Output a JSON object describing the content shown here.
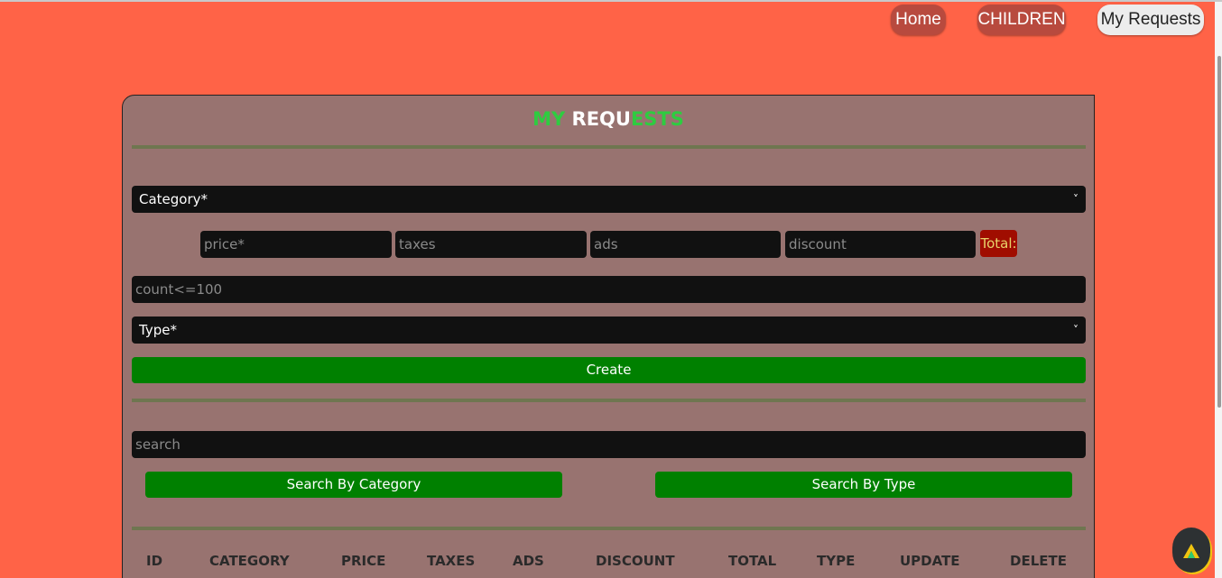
{
  "nav": {
    "home": "Home",
    "children": "CHILDREN",
    "requests": "My Requests"
  },
  "title": {
    "part1": "MY ",
    "part2": "REQU",
    "part3": "ESTS"
  },
  "form": {
    "category_select": "Category*",
    "price_placeholder": "price*",
    "taxes_placeholder": "taxes",
    "ads_placeholder": "ads",
    "discount_placeholder": "discount",
    "total_label": "Total:",
    "count_placeholder": "count<=100",
    "type_select": "Type*",
    "create_button": "Create"
  },
  "search": {
    "placeholder": "search",
    "by_category": "Search By Category",
    "by_type": "Search By Type"
  },
  "table": {
    "headers": [
      "ID",
      "CATEGORY",
      "PRICE",
      "TAXES",
      "ADS",
      "DISCOUNT",
      "TOTAL",
      "TYPE",
      "UPDATE",
      "DELETE"
    ]
  },
  "colors": {
    "background": "#ff6347",
    "panel": "#987370",
    "input": "#111111",
    "button": "#008000",
    "total": "#a00d00",
    "title_green": "#2ecc40"
  },
  "icons": {
    "scroll_top": "scroll-to-top-icon",
    "select_arrow": "chevron-down-icon"
  }
}
